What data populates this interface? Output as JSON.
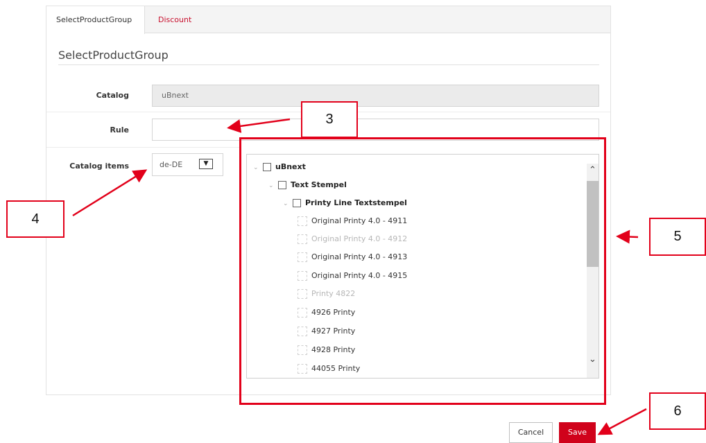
{
  "tabs": [
    {
      "label": "SelectProductGroup",
      "active": true
    },
    {
      "label": "Discount",
      "active": false
    }
  ],
  "section_title": "SelectProductGroup",
  "form": {
    "catalog": {
      "label": "Catalog",
      "value": "uBnext"
    },
    "rule": {
      "label": "Rule",
      "value": "",
      "placeholder": ""
    },
    "catalog_items": {
      "label": "Catalog items",
      "language": "de-DE"
    }
  },
  "tree": {
    "items": [
      {
        "label": "uBnext",
        "level": 0,
        "parent": true,
        "expanded": true,
        "disabled": false
      },
      {
        "label": "Text Stempel",
        "level": 1,
        "parent": true,
        "expanded": true,
        "disabled": false
      },
      {
        "label": "Printy Line Textstempel",
        "level": 2,
        "parent": true,
        "expanded": true,
        "disabled": false
      },
      {
        "label": "Original Printy 4.0 - 4911",
        "level": 3,
        "parent": false,
        "disabled": false
      },
      {
        "label": "Original Printy 4.0 - 4912",
        "level": 3,
        "parent": false,
        "disabled": true
      },
      {
        "label": "Original Printy 4.0 - 4913",
        "level": 3,
        "parent": false,
        "disabled": false
      },
      {
        "label": "Original Printy 4.0 - 4915",
        "level": 3,
        "parent": false,
        "disabled": false
      },
      {
        "label": "Printy 4822",
        "level": 3,
        "parent": false,
        "disabled": true
      },
      {
        "label": "4926 Printy",
        "level": 3,
        "parent": false,
        "disabled": false
      },
      {
        "label": "4927 Printy",
        "level": 3,
        "parent": false,
        "disabled": false
      },
      {
        "label": "4928 Printy",
        "level": 3,
        "parent": false,
        "disabled": false
      },
      {
        "label": "44055 Printy",
        "level": 3,
        "parent": false,
        "disabled": false
      }
    ]
  },
  "buttons": {
    "cancel": "Cancel",
    "save": "Save"
  },
  "callouts": {
    "c3": "3",
    "c4": "4",
    "c5": "5",
    "c6": "6"
  },
  "colors": {
    "accent": "#d0021b",
    "annotation": "#e2001a"
  },
  "icons": {
    "expand": "chevron-down-icon",
    "scroll_up": "chevron-up-icon",
    "scroll_down": "chevron-down-icon"
  }
}
